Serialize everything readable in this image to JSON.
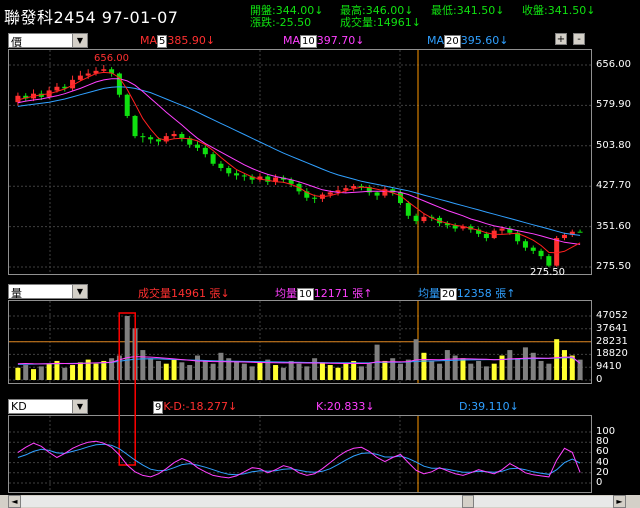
{
  "header": {
    "title": "聯發科2454  97-01-07",
    "open_label": "開盤:344.00",
    "high_label": "最高:346.00",
    "low_label": "最低:341.50",
    "close_label": "收盤:341.50",
    "change_label": "漲跌:-25.50",
    "volume_label": "成交量:14961",
    "down_arrow": "↓",
    "up_arrow": "↑"
  },
  "price_panel": {
    "select": "價",
    "ma1_label": "MA",
    "ma1_period": "5",
    "ma1_value": "385.90",
    "ma2_label": "MA",
    "ma2_period": "10",
    "ma2_value": "397.70",
    "ma3_label": "MA",
    "ma3_period": "20",
    "ma3_value": "395.60",
    "plus_btn": "+",
    "minus_btn": "-",
    "high_marker": "656.00",
    "low_marker": "275.50",
    "axis_ticks": [
      "656.00",
      "579.90",
      "503.80",
      "427.70",
      "351.60",
      "275.50"
    ]
  },
  "volume_panel": {
    "select": "量",
    "vol_label": "成交量",
    "vol_value": "14961",
    "vol_unit": "張",
    "avg1_label": "均量",
    "avg1_period": "10",
    "avg1_value": "12171",
    "avg1_unit": "張",
    "avg2_label": "均量",
    "avg2_period": "20",
    "avg2_value": "12358",
    "avg2_unit": "張",
    "axis_ticks": [
      "47052",
      "37641",
      "28231",
      "18820",
      "9410",
      "0"
    ]
  },
  "kd_panel": {
    "select": "KD",
    "period": "9",
    "kd_diff_label": "K-D:-18.277",
    "k_label": "K:20.833",
    "d_label": "D:39.110",
    "axis_ticks": [
      "100",
      "80",
      "60",
      "40",
      "20",
      "0"
    ]
  },
  "scrollbar": {
    "left_arrow": "◄",
    "right_arrow": "►"
  },
  "colors": {
    "up": "#ff3030",
    "down": "#10e010",
    "ma5": "#ff2020",
    "ma10": "#ff40ff",
    "ma20": "#30a0ff",
    "volume_up": "#ffff30",
    "volume_down": "#808080",
    "marker_line": "#ff9900",
    "highlight_box": "#ff0000"
  },
  "chart_data": {
    "type": "candlestick",
    "price_axis": {
      "ylim": [
        275.5,
        656.0
      ]
    },
    "volume_axis": {
      "ylim": [
        0,
        47052
      ]
    },
    "kd_axis": {
      "ylim": [
        0,
        100
      ]
    },
    "candles": [
      [
        586,
        598,
        604,
        580
      ],
      [
        598,
        593,
        603,
        587
      ],
      [
        593,
        602,
        610,
        588
      ],
      [
        602,
        596,
        608,
        590
      ],
      [
        596,
        608,
        615,
        592
      ],
      [
        608,
        615,
        622,
        604
      ],
      [
        615,
        612,
        620,
        606
      ],
      [
        612,
        628,
        636,
        608
      ],
      [
        628,
        636,
        645,
        626
      ],
      [
        636,
        640,
        648,
        630
      ],
      [
        640,
        645,
        652,
        636
      ],
      [
        645,
        648,
        656,
        642
      ],
      [
        648,
        640,
        652,
        634
      ],
      [
        640,
        600,
        642,
        595
      ],
      [
        600,
        560,
        602,
        556
      ],
      [
        560,
        522,
        562,
        518
      ],
      [
        522,
        520,
        528,
        510
      ],
      [
        520,
        516,
        524,
        508
      ],
      [
        516,
        512,
        520,
        505
      ],
      [
        512,
        522,
        528,
        508
      ],
      [
        522,
        526,
        532,
        518
      ],
      [
        526,
        518,
        530,
        512
      ],
      [
        518,
        506,
        522,
        500
      ],
      [
        506,
        500,
        512,
        494
      ],
      [
        500,
        488,
        505,
        482
      ],
      [
        488,
        470,
        492,
        466
      ],
      [
        470,
        462,
        475,
        456
      ],
      [
        462,
        452,
        466,
        446
      ],
      [
        452,
        448,
        458,
        440
      ],
      [
        448,
        446,
        452,
        438
      ],
      [
        446,
        440,
        450,
        432
      ],
      [
        440,
        446,
        452,
        436
      ],
      [
        446,
        436,
        450,
        430
      ],
      [
        436,
        444,
        450,
        430
      ],
      [
        444,
        440,
        448,
        434
      ],
      [
        440,
        432,
        444,
        426
      ],
      [
        432,
        418,
        436,
        412
      ],
      [
        418,
        406,
        424,
        400
      ],
      [
        406,
        404,
        412,
        396
      ],
      [
        404,
        412,
        416,
        398
      ],
      [
        412,
        416,
        420,
        406
      ],
      [
        416,
        420,
        428,
        410
      ],
      [
        420,
        424,
        430,
        414
      ],
      [
        424,
        428,
        432,
        418
      ],
      [
        428,
        426,
        432,
        420
      ],
      [
        426,
        416,
        430,
        410
      ],
      [
        416,
        410,
        418,
        402
      ],
      [
        410,
        422,
        428,
        406
      ],
      [
        422,
        416,
        426,
        410
      ],
      [
        416,
        396,
        420,
        392
      ],
      [
        396,
        372,
        400,
        366
      ],
      [
        372,
        362,
        376,
        356
      ],
      [
        362,
        370,
        376,
        358
      ],
      [
        370,
        368,
        374,
        362
      ],
      [
        368,
        358,
        372,
        352
      ],
      [
        358,
        354,
        362,
        348
      ],
      [
        354,
        348,
        358,
        342
      ],
      [
        348,
        352,
        356,
        344
      ],
      [
        352,
        346,
        356,
        340
      ],
      [
        346,
        338,
        350,
        332
      ],
      [
        338,
        330,
        342,
        324
      ],
      [
        330,
        344,
        348,
        328
      ],
      [
        344,
        348,
        352,
        338
      ],
      [
        348,
        340,
        352,
        336
      ],
      [
        340,
        324,
        344,
        318
      ],
      [
        324,
        312,
        328,
        306
      ],
      [
        312,
        306,
        316,
        300
      ],
      [
        306,
        296,
        310,
        290
      ],
      [
        296,
        278,
        300,
        275.5
      ],
      [
        278,
        330,
        334,
        276
      ],
      [
        330,
        336,
        340,
        326
      ],
      [
        336,
        342,
        346,
        332
      ],
      [
        342,
        341.5,
        346,
        341.5
      ]
    ],
    "ma5": [
      590,
      594,
      597,
      600,
      602,
      606,
      611,
      618,
      626,
      633,
      640,
      642,
      641,
      632,
      610,
      583,
      555,
      535,
      518,
      514,
      517,
      518,
      517,
      513,
      506,
      495,
      482,
      470,
      459,
      452,
      445,
      441,
      439,
      436,
      435,
      431,
      425,
      416,
      410,
      408,
      410,
      414,
      419,
      423,
      426,
      425,
      422,
      419,
      415,
      410,
      398,
      387,
      376,
      368,
      362,
      358,
      354,
      352,
      348,
      345,
      340,
      337,
      337,
      338,
      339,
      333,
      326,
      316,
      303,
      302,
      305,
      313,
      321
    ],
    "ma10": [
      585,
      588,
      590,
      592,
      595,
      598,
      602,
      607,
      612,
      618,
      624,
      628,
      630,
      630,
      626,
      618,
      606,
      593,
      580,
      567,
      555,
      543,
      530,
      518,
      508,
      500,
      492,
      484,
      476,
      468,
      461,
      455,
      450,
      446,
      443,
      440,
      436,
      431,
      426,
      421,
      418,
      416,
      415,
      416,
      417,
      418,
      418,
      418,
      418,
      416,
      412,
      406,
      400,
      394,
      388,
      382,
      377,
      372,
      366,
      362,
      357,
      353,
      350,
      347,
      344,
      341,
      338,
      334,
      330,
      326,
      322,
      320,
      318
    ],
    "ma20": [
      578,
      580,
      582,
      584,
      586,
      589,
      592,
      596,
      600,
      604,
      608,
      612,
      614,
      615,
      614,
      612,
      608,
      604,
      598,
      592,
      586,
      580,
      574,
      567,
      560,
      553,
      546,
      539,
      532,
      525,
      518,
      511,
      504,
      497,
      490,
      484,
      478,
      472,
      466,
      460,
      454,
      449,
      445,
      441,
      437,
      434,
      431,
      428,
      425,
      422,
      419,
      415,
      411,
      407,
      403,
      399,
      395,
      391,
      387,
      383,
      379,
      375,
      371,
      367,
      363,
      359,
      355,
      351,
      347,
      343,
      339,
      337,
      335
    ],
    "volume": [
      9000,
      11000,
      8000,
      10000,
      12000,
      14000,
      9000,
      11000,
      13000,
      15000,
      12000,
      14000,
      16000,
      18000,
      47052,
      38000,
      22000,
      16000,
      14000,
      12000,
      15000,
      13000,
      11000,
      18000,
      14000,
      12000,
      20000,
      16000,
      14000,
      12000,
      10000,
      13000,
      15000,
      11000,
      9000,
      14000,
      12000,
      10000,
      16000,
      13000,
      11000,
      9000,
      12000,
      14000,
      10000,
      12000,
      26000,
      14000,
      16000,
      12000,
      15000,
      30000,
      20000,
      14000,
      12000,
      22000,
      18000,
      16000,
      12000,
      14000,
      10000,
      12000,
      18000,
      22000,
      16000,
      24000,
      20000,
      14000,
      12000,
      30000,
      22000,
      18000,
      14961
    ],
    "vol_avg10": [
      12000,
      12100,
      11900,
      11800,
      12000,
      12200,
      12100,
      12000,
      12200,
      12400,
      12600,
      12800,
      13100,
      14800,
      16500,
      17200,
      17000,
      16800,
      16500,
      16000,
      15500,
      15000,
      14500,
      14000,
      13800,
      13500,
      13500,
      13400,
      13300,
      13200,
      13000,
      12900,
      12800,
      12700,
      12600,
      12700,
      12600,
      12500,
      12600,
      12400,
      12300,
      12200,
      12100,
      12200,
      12100,
      12200,
      13400,
      13300,
      13400,
      13300,
      13500,
      14800,
      15100,
      15000,
      14900,
      15300,
      15500,
      15600,
      15500,
      15400,
      15200,
      14900,
      15100,
      15500,
      15700,
      16000,
      16200,
      16100,
      16000,
      16500,
      16800,
      16900,
      12171
    ],
    "vol_avg20": [
      11500,
      11600,
      11700,
      11800,
      11900,
      12000,
      12100,
      12200,
      12300,
      12400,
      12500,
      12700,
      12900,
      13800,
      14600,
      15200,
      15500,
      15600,
      15500,
      15300,
      15100,
      14900,
      14700,
      14500,
      14300,
      14100,
      14000,
      13900,
      13800,
      13700,
      13600,
      13500,
      13400,
      13300,
      13200,
      13100,
      13000,
      12900,
      12850,
      12800,
      12750,
      12700,
      12650,
      12650,
      12600,
      12650,
      12900,
      13000,
      13050,
      13100,
      13200,
      13700,
      13900,
      14000,
      14100,
      14300,
      14500,
      14700,
      14800,
      14900,
      15000,
      15000,
      15100,
      15300,
      15400,
      15600,
      15700,
      15800,
      15900,
      16100,
      16300,
      16400,
      12358
    ],
    "k": [
      60,
      70,
      78,
      72,
      60,
      50,
      58,
      68,
      75,
      80,
      82,
      78,
      70,
      55,
      35,
      22,
      15,
      12,
      18,
      28,
      40,
      48,
      42,
      30,
      22,
      15,
      12,
      10,
      14,
      22,
      30,
      28,
      20,
      26,
      34,
      30,
      20,
      15,
      18,
      28,
      40,
      52,
      62,
      68,
      70,
      62,
      50,
      42,
      50,
      56,
      40,
      25,
      18,
      22,
      30,
      24,
      18,
      15,
      20,
      26,
      22,
      18,
      26,
      38,
      30,
      20,
      16,
      14,
      12,
      45,
      68,
      60,
      20.833
    ],
    "d": [
      50,
      55,
      62,
      66,
      64,
      59,
      58,
      62,
      66,
      71,
      75,
      76,
      74,
      67,
      56,
      45,
      35,
      27,
      24,
      25,
      30,
      36,
      38,
      35,
      31,
      26,
      21,
      17,
      16,
      18,
      22,
      24,
      23,
      24,
      27,
      28,
      25,
      22,
      21,
      23,
      28,
      36,
      45,
      53,
      58,
      59,
      56,
      51,
      51,
      53,
      48,
      41,
      33,
      29,
      29,
      27,
      24,
      21,
      21,
      23,
      22,
      21,
      23,
      28,
      29,
      26,
      22,
      19,
      17,
      26,
      40,
      47,
      39.11
    ]
  }
}
